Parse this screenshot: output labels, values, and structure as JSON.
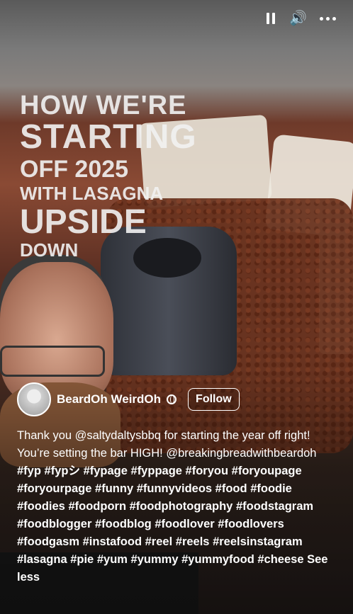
{
  "controls": {
    "pause_icon": "pause-icon",
    "volume_icon": "volume-icon",
    "more_icon": "more-icon"
  },
  "overlay": {
    "line1": "HOW WE'RE",
    "line2": "STARTING",
    "line3": "OFF 2025",
    "line4": "WITH LASAGNA",
    "line5": "UPSIDE",
    "line6": "DOWN"
  },
  "author": {
    "name": "BeardOh WeirdOh",
    "follow_label": "Follow"
  },
  "description": {
    "text_part1": "Thank you @saltydaltysbbq for starting the year off right! You’re setting the bar HIGH! @breakingbreadwithbeardoh",
    "hashtags": [
      "#fyp",
      "#fypシ",
      "#fypage",
      "#fyppage",
      "#foryou",
      "#foryoupage",
      "#foryourpage",
      "#funny",
      "#funnyvideos",
      "#food",
      "#foodie",
      "#foodies",
      "#foodporn",
      "#foodphotography",
      "#foodstagram",
      "#foodblogger",
      "#foodblog",
      "#foodlover",
      "#foodlovers",
      "#foodgasm",
      "#instafood",
      "#reel",
      "#reels",
      "#reelsinstagram",
      "#lasagna",
      "#pie",
      "#yum",
      "#yummy",
      "#yummyfood",
      "#cheese"
    ],
    "see_less_label": "See less"
  }
}
